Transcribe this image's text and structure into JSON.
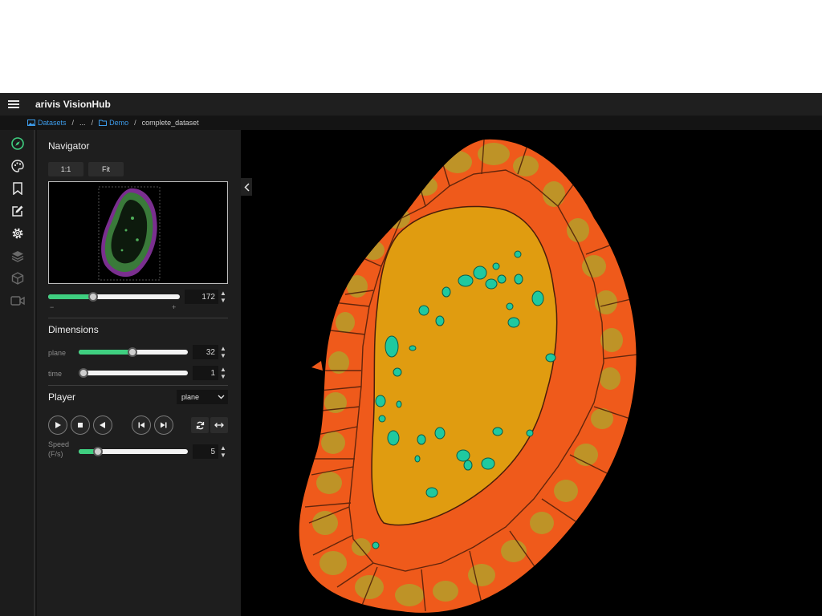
{
  "app": {
    "title": "arivis VisionHub"
  },
  "breadcrumb": {
    "datasets": "Datasets",
    "ellipsis": "...",
    "folder": "Demo",
    "current": "complete_dataset",
    "separator": "/"
  },
  "sidebar": {
    "icons": [
      "compass-icon",
      "palette-icon",
      "bookmark-icon",
      "edit-icon",
      "settings-icon",
      "layers-icon",
      "cube-icon",
      "video-icon"
    ],
    "active": "compass-icon"
  },
  "navigator": {
    "title": "Navigator",
    "btn_one_to_one": "1:1",
    "btn_fit": "Fit",
    "zoom_value": "172",
    "zoom_fraction": 0.34,
    "minus": "−",
    "plus": "+"
  },
  "dimensions": {
    "title": "Dimensions",
    "plane_label": "plane",
    "plane_value": "32",
    "plane_fraction": 0.49,
    "time_label": "time",
    "time_value": "1",
    "time_fraction": 0.0
  },
  "player": {
    "title": "Player",
    "mode": "plane",
    "speed_label": "Speed\n(F/s)",
    "speed_value": "5",
    "speed_fraction": 0.18
  },
  "colors": {
    "accent": "#3fcf80",
    "link": "#3d9be9",
    "tissue_outer": "#ef5a1b",
    "tissue_cells": "#b99a2a",
    "tissue_core": "#e09c10",
    "nuclei": "#1fc9a0"
  }
}
